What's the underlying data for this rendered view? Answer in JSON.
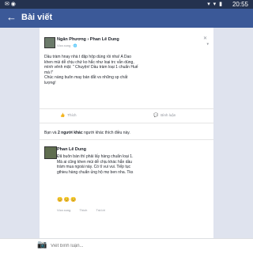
{
  "status": {
    "time": "20:55",
    "icons": "▾ ▾ ▮",
    "left_icons": "✉ ◉"
  },
  "nav": {
    "back_icon": "←",
    "title": "Bài viết"
  },
  "post": {
    "author": "Ngân Phương › Phan Lê Dung",
    "meta": "Vừa xong · 🌐",
    "dismiss_icon": "✕",
    "more_icon": "▾",
    "text": "Dầu tràm hnay nhà t đập hộp dùng rồi nha! A Dao\nkhen mùi dễ chịu chứ ko hắc như loại trc vẫn dùng,\nmình vênh mặt: \" Chuyện! Dầu tràm loại 1 chuẩn Huế\nmà l\"\nChúc nàng buôn may bán đắt vs những sp chất\nlượng!",
    "like_icon": "👍",
    "like_label": "Thích",
    "comment_icon": "💬",
    "comment_label": "Bình luận",
    "likes_prefix": "Bạn và",
    "likes_bold": "2 người khác",
    "likes_suffix": "người khác thích điều này."
  },
  "comment": {
    "name": "Phan Lê Dung",
    "text": "Đã buôn bán thì phải lấy hàng chuẩn loại 1.\nMà ai cũng khen mùi dễ chịu khác hẳn dầu\ntràm mua ngoài này. Có tí vui vui. Tiếp tục\ngthieu hàng chuẩn ủng hộ mẹ ben nha. Tks",
    "emojis": "😊😊😊",
    "time": "Vừa xong",
    "like": "Thích",
    "reply": "Trả lời"
  },
  "composer": {
    "camera_icon": "📷",
    "placeholder": "Viết bình luận..."
  }
}
